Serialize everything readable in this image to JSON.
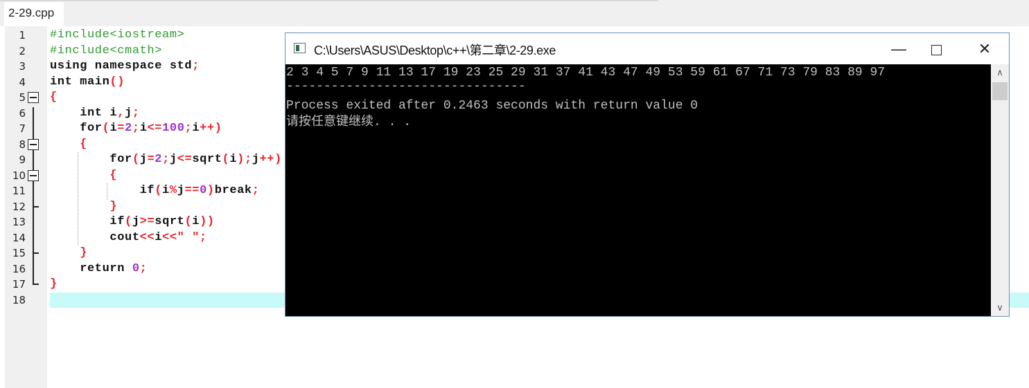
{
  "tabs": [
    {
      "label": "2-29.cpp",
      "active": true
    }
  ],
  "editor": {
    "current_line": 18,
    "lines": [
      {
        "n": "1",
        "tokens": [
          {
            "t": "#include<iostream>",
            "c": "p"
          }
        ]
      },
      {
        "n": "2",
        "tokens": [
          {
            "t": "#include<cmath>",
            "c": "p"
          }
        ]
      },
      {
        "n": "3",
        "tokens": [
          {
            "t": "using namespace std",
            "c": "k"
          },
          {
            "t": ";",
            "c": "s"
          }
        ]
      },
      {
        "n": "4",
        "tokens": [
          {
            "t": "int main",
            "c": "k"
          },
          {
            "t": "()",
            "c": "s"
          }
        ]
      },
      {
        "n": "5",
        "tokens": [
          {
            "t": "{",
            "c": "s"
          }
        ]
      },
      {
        "n": "6",
        "tokens": [
          {
            "t": "    int i",
            "c": "k"
          },
          {
            "t": ",",
            "c": "s"
          },
          {
            "t": "j",
            "c": "k"
          },
          {
            "t": ";",
            "c": "s"
          }
        ]
      },
      {
        "n": "7",
        "tokens": [
          {
            "t": "    for",
            "c": "k"
          },
          {
            "t": "(",
            "c": "s"
          },
          {
            "t": "i",
            "c": "k"
          },
          {
            "t": "=",
            "c": "s"
          },
          {
            "t": "2",
            "c": "n"
          },
          {
            "t": ";",
            "c": "s"
          },
          {
            "t": "i",
            "c": "k"
          },
          {
            "t": "<=",
            "c": "s"
          },
          {
            "t": "100",
            "c": "n"
          },
          {
            "t": ";",
            "c": "s"
          },
          {
            "t": "i",
            "c": "k"
          },
          {
            "t": "++)",
            "c": "s"
          }
        ]
      },
      {
        "n": "8",
        "tokens": [
          {
            "t": "    {",
            "c": "s"
          }
        ]
      },
      {
        "n": "9",
        "tokens": [
          {
            "t": "        for",
            "c": "k"
          },
          {
            "t": "(",
            "c": "s"
          },
          {
            "t": "j",
            "c": "k"
          },
          {
            "t": "=",
            "c": "s"
          },
          {
            "t": "2",
            "c": "n"
          },
          {
            "t": ";",
            "c": "s"
          },
          {
            "t": "j",
            "c": "k"
          },
          {
            "t": "<=",
            "c": "s"
          },
          {
            "t": "sqrt",
            "c": "k"
          },
          {
            "t": "(",
            "c": "s"
          },
          {
            "t": "i",
            "c": "k"
          },
          {
            "t": ");",
            "c": "s"
          },
          {
            "t": "j",
            "c": "k"
          },
          {
            "t": "++)",
            "c": "s"
          }
        ]
      },
      {
        "n": "10",
        "tokens": [
          {
            "t": "        {",
            "c": "s"
          }
        ]
      },
      {
        "n": "11",
        "tokens": [
          {
            "t": "            if",
            "c": "k"
          },
          {
            "t": "(",
            "c": "s"
          },
          {
            "t": "i",
            "c": "k"
          },
          {
            "t": "%",
            "c": "s"
          },
          {
            "t": "j",
            "c": "k"
          },
          {
            "t": "==",
            "c": "s"
          },
          {
            "t": "0",
            "c": "n"
          },
          {
            "t": ")",
            "c": "s"
          },
          {
            "t": "break",
            "c": "k"
          },
          {
            "t": ";",
            "c": "s"
          }
        ]
      },
      {
        "n": "12",
        "tokens": [
          {
            "t": "        }",
            "c": "s"
          }
        ]
      },
      {
        "n": "13",
        "tokens": [
          {
            "t": "        if",
            "c": "k"
          },
          {
            "t": "(",
            "c": "s"
          },
          {
            "t": "j",
            "c": "k"
          },
          {
            "t": ">=",
            "c": "s"
          },
          {
            "t": "sqrt",
            "c": "k"
          },
          {
            "t": "(",
            "c": "s"
          },
          {
            "t": "i",
            "c": "k"
          },
          {
            "t": "))",
            "c": "s"
          }
        ]
      },
      {
        "n": "14",
        "tokens": [
          {
            "t": "        cout",
            "c": "k"
          },
          {
            "t": "<<",
            "c": "s"
          },
          {
            "t": "i",
            "c": "k"
          },
          {
            "t": "<<\" \";",
            "c": "s"
          }
        ]
      },
      {
        "n": "15",
        "tokens": [
          {
            "t": "    }",
            "c": "s"
          }
        ]
      },
      {
        "n": "16",
        "tokens": [
          {
            "t": "    return ",
            "c": "k"
          },
          {
            "t": "0",
            "c": "n"
          },
          {
            "t": ";",
            "c": "s"
          }
        ]
      },
      {
        "n": "17",
        "tokens": [
          {
            "t": "}",
            "c": "s"
          }
        ]
      },
      {
        "n": "18",
        "tokens": []
      }
    ]
  },
  "console": {
    "title": "C:\\Users\\ASUS\\Desktop\\c++\\第二章\\2-29.exe",
    "minimize_icon": "minimize-icon",
    "maximize_icon": "maximize-icon",
    "close_icon": "close-icon",
    "output": [
      "2 3 4 5 7 9 11 13 17 19 23 25 29 31 37 41 43 47 49 53 59 61 67 71 73 79 83 89 97",
      "--------------------------------",
      "Process exited after 0.2463 seconds with return value 0",
      "请按任意键继续. . ."
    ]
  },
  "colors": {
    "keyword": "#111111",
    "preprocessor": "#2f9a2f",
    "symbol": "#e8232a",
    "number": "#9b30c9",
    "current_line": "#c8fafa",
    "console_bg": "#000000",
    "console_text": "#c0c0c0"
  }
}
